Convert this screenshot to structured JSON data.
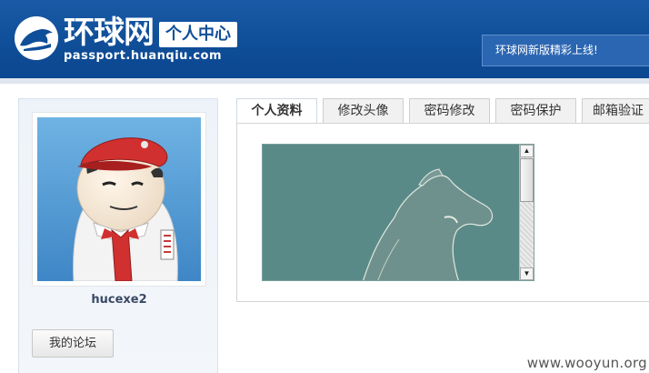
{
  "header": {
    "brand": "环球网",
    "badge": "个人中心",
    "domain": "passport.huanqiu.com",
    "news_link": "环球网新版精彩上线!",
    "logo_icon": "horse-logo-icon"
  },
  "sidebar": {
    "username": "hucexe2",
    "forum_button": "我的论坛",
    "avatar_icon": "avatar-image"
  },
  "tabs": [
    {
      "label": "个人资料",
      "active": true
    },
    {
      "label": "修改头像",
      "active": false
    },
    {
      "label": "密码修改",
      "active": false
    },
    {
      "label": "密码保护",
      "active": false
    },
    {
      "label": "邮箱验证",
      "active": false
    }
  ],
  "content": {
    "image_icon": "horse-head-image"
  },
  "watermark": "www.wooyun.org",
  "colors": {
    "header_bg": "#0f4e98",
    "news_bg": "#2b66b2",
    "upload_bg": "#5a8a87"
  }
}
